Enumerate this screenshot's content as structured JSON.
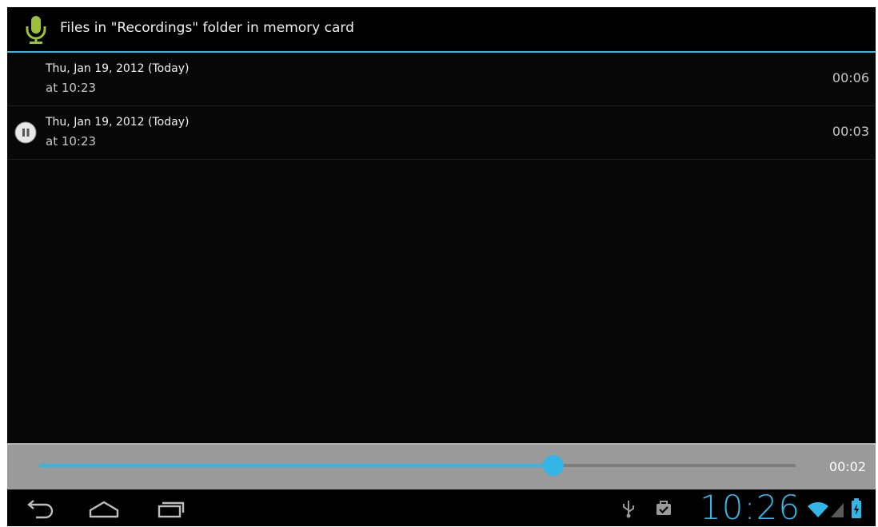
{
  "header": {
    "title": "Files in \"Recordings\" folder in memory card",
    "icon": "microphone-icon"
  },
  "recordings": [
    {
      "date": "Thu, Jan 19, 2012 (Today)",
      "time": "at 10:23",
      "duration": "00:06",
      "playing": false
    },
    {
      "date": "Thu, Jan 19, 2012 (Today)",
      "time": "at 10:23",
      "duration": "00:03",
      "playing": true
    }
  ],
  "player": {
    "elapsed": "00:02",
    "progress_percent": 68
  },
  "system_bar": {
    "clock": "10:26",
    "nav_icons": [
      "back-icon",
      "home-icon",
      "recent-apps-icon"
    ],
    "status_icons": [
      "usb-icon",
      "task-bag-icon",
      "wifi-icon",
      "signal-icon",
      "battery-icon"
    ]
  },
  "colors": {
    "accent": "#33b5e5",
    "mic_green": "#9dbf3a",
    "background": "#070707",
    "player_bar": "#9a9a9a"
  }
}
